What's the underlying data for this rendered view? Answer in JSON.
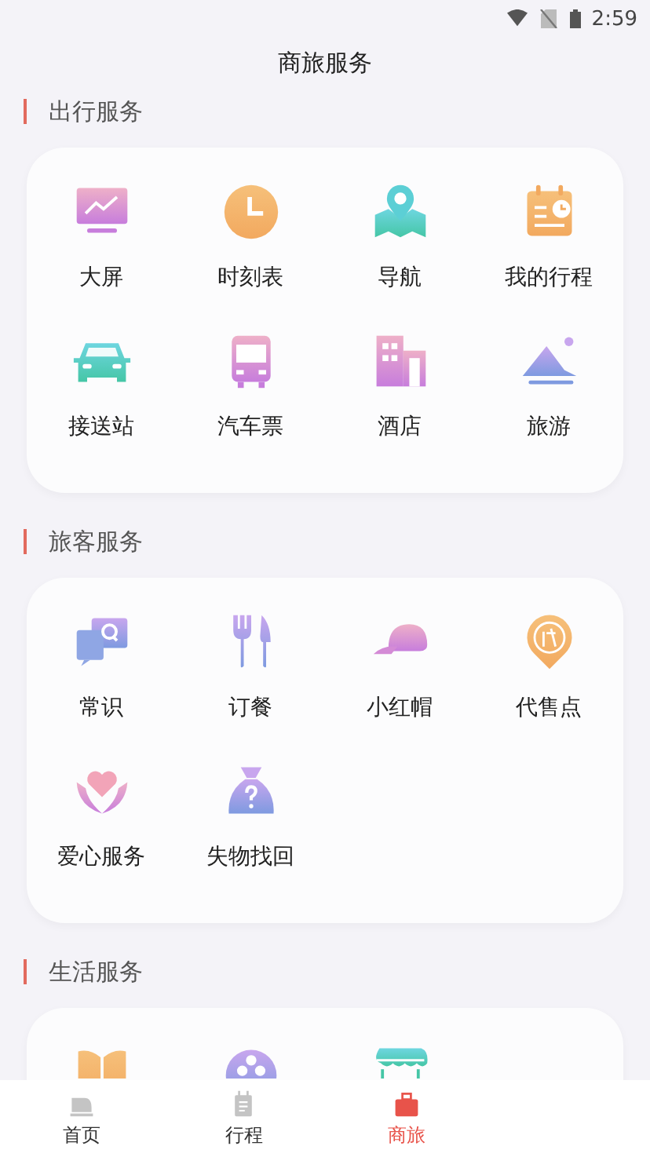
{
  "status_bar": {
    "time": "2:59"
  },
  "title": "商旅服务",
  "sections": [
    {
      "title": "出行服务",
      "items": [
        {
          "label": "大屏"
        },
        {
          "label": "时刻表"
        },
        {
          "label": "导航"
        },
        {
          "label": "我的行程"
        },
        {
          "label": "接送站"
        },
        {
          "label": "汽车票"
        },
        {
          "label": "酒店"
        },
        {
          "label": "旅游"
        }
      ]
    },
    {
      "title": "旅客服务",
      "items": [
        {
          "label": "常识"
        },
        {
          "label": "订餐"
        },
        {
          "label": "小红帽"
        },
        {
          "label": "代售点"
        },
        {
          "label": "爱心服务"
        },
        {
          "label": "失物找回"
        }
      ]
    },
    {
      "title": "生活服务",
      "items": [
        {
          "kind": "cut_off"
        },
        {
          "kind": "cut_off"
        },
        {
          "kind": "cut_off"
        }
      ]
    }
  ],
  "tabs": [
    {
      "label": "首页",
      "selected": false
    },
    {
      "label": "行程",
      "selected": false
    },
    {
      "label": "商旅",
      "selected": true
    }
  ]
}
